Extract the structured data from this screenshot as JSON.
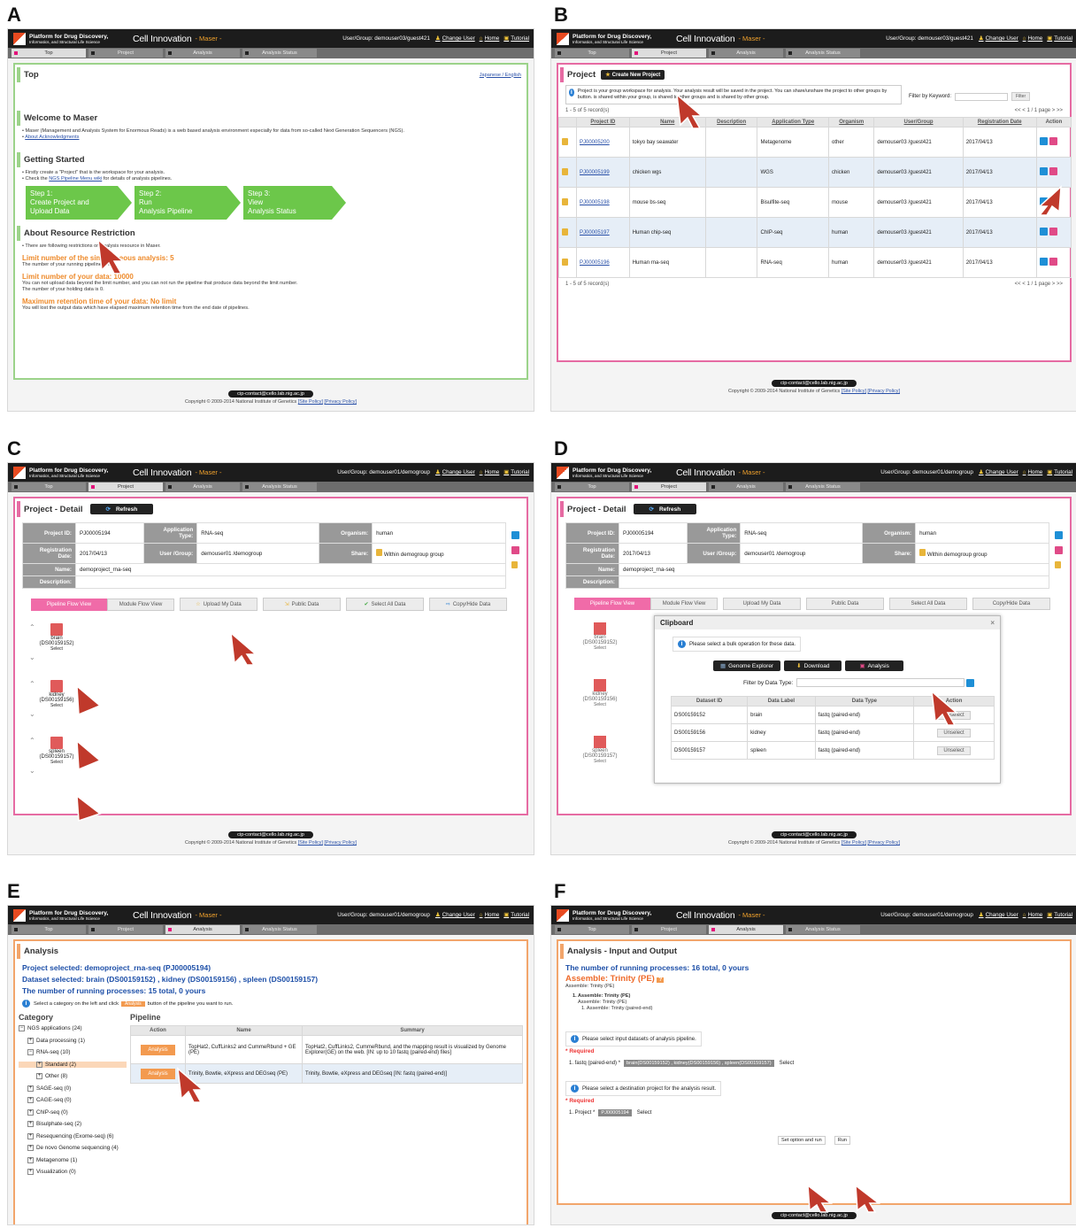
{
  "panel_labels": [
    "A",
    "B",
    "C",
    "D",
    "E",
    "F"
  ],
  "header": {
    "platform": "Platform for Drug Discovery,",
    "platform_sub": "Informatics, and Structural Life Science",
    "nig": "National Institute of Genetics",
    "cellinnovation": "Cell Innovation",
    "maser": "- Maser -",
    "change_user": "Change User",
    "home": "Home",
    "tutorial": "Tutorial",
    "tabs": [
      "Top",
      "Project",
      "Analysis",
      "Analysis Status"
    ]
  },
  "users": {
    "guest": "User/Group: demouser03/guest421",
    "demo": "User/Group: demouser01/demogroup"
  },
  "footer": {
    "contact": "cip-contact@cello.lab.nig.ac.jp",
    "copyright": "Copyright © 2009-2014 National Institute of Genetics",
    "site_policy": "[Site Policy]",
    "privacy_policy": "[Privacy Policy]"
  },
  "panel_a": {
    "title": "Top",
    "lang": "Japanese / English",
    "welcome_title": "Welcome to Maser",
    "welcome_text": "Maser (Management and Analysis System for Enormous Reads) is a web based analysis environment especially for data from so-called Next Generation Sequencers (NGS).",
    "ack_link": "About Acknowledgments",
    "getting_started": "Getting Started",
    "gs_line1": "Firstly create a \"Project\" that is the workspace for your analysis.",
    "gs_line2_pre": "Check the",
    "gs_line2_link": "NGS Pipeline Menu wiki",
    "gs_line2_post": "for details of analysis pipelines.",
    "steps": [
      {
        "l1": "Step 1:",
        "l2": "Create Project and",
        "l3": "Upload Data"
      },
      {
        "l1": "Step 2:",
        "l2": "Run",
        "l3": "Analysis Pipeline"
      },
      {
        "l1": "Step 3:",
        "l2": "View",
        "l3": "Analysis Status"
      }
    ],
    "about_resource": "About Resource Restriction",
    "restriction_intro": "There are following restrictions on analysis resource in Maser.",
    "limit1": "Limit number of the simultaneous analysis: 5",
    "limit1_text": "The number of your running pipeline is 0.",
    "limit2": "Limit number of your data: 10000",
    "limit2_text1": "You can not upload data beyond the limit number, and you can not run the pipeline that produce data beyond the limit number.",
    "limit2_text2": "The number of your holding data is 0.",
    "limit3": "Maximum retention time of your data: No limit",
    "limit3_text": "You will lost the output data which have elapsed maximum retention time from the end date of pipelines."
  },
  "panel_b": {
    "title": "Project",
    "create_btn": "Create New Project",
    "info_text": "Project is your group workspace for analysis. Your analysis result will be saved in the project. You can share/unshare the project to other groups by button. is shared within your group, is shared to other groups and is shared by other group.",
    "filter_label": "Filter by Keyword:",
    "filter_btn": "Filter",
    "records": "1 - 5 of 5 record(s)",
    "pager": "<< < 1 / 1 page > >>",
    "columns": [
      "Project ID",
      "Name",
      "Description",
      "Application Type",
      "Organism",
      "User/Group",
      "Registration Date",
      "Action"
    ],
    "rows": [
      [
        "PJ00005200",
        "tokyo bay seawater",
        "",
        "Metagenome",
        "other",
        "demouser03 /guest421",
        "2017/04/13"
      ],
      [
        "PJ00005199",
        "chicken wgs",
        "",
        "WGS",
        "chicken",
        "demouser03 /guest421",
        "2017/04/13"
      ],
      [
        "PJ00005198",
        "mouse bs-seq",
        "",
        "Bisulfite-seq",
        "mouse",
        "demouser03 /guest421",
        "2017/04/13"
      ],
      [
        "PJ00005197",
        "Human chip-seq",
        "",
        "ChIP-seq",
        "human",
        "demouser03 /guest421",
        "2017/04/13"
      ],
      [
        "PJ00005196",
        "Human rna-seq",
        "",
        "RNA-seq",
        "human",
        "demouser03 /guest421",
        "2017/04/13"
      ]
    ]
  },
  "panel_c": {
    "title": "Project - Detail",
    "refresh": "Refresh",
    "fields": {
      "project_id_k": "Project ID:",
      "project_id": "PJ00005194",
      "app_type_k": "Application Type:",
      "app_type": "RNA-seq",
      "organism_k": "Organism:",
      "organism": "human",
      "reg_k": "Registration Date:",
      "reg": "2017/04/13",
      "user_k": "User /Group:",
      "user": "demouser01 /demogroup",
      "share_k": "Share:",
      "share": "Within demogroup group",
      "name_k": "Name:",
      "name": "demoproject_rna-seq",
      "desc_k": "Description:",
      "desc": ""
    },
    "buttons": [
      "Pipeline Flow View",
      "Module Flow View",
      "Upload My Data",
      "Public Data",
      "Select All Data",
      "Copy/Hide Data"
    ],
    "datasets": [
      {
        "name": "brain",
        "id": "(DS00159152)"
      },
      {
        "name": "kidney",
        "id": "(DS00159156)"
      },
      {
        "name": "spleen",
        "id": "(DS00159157)"
      }
    ],
    "select": "Select"
  },
  "panel_d": {
    "clipboard": "Clipboard",
    "bulk_info": "Please select a bulk operation for these data.",
    "ops": [
      "Genome Explorer",
      "Download",
      "Analysis"
    ],
    "filter_type": "Filter by Data Type:",
    "columns": [
      "Dataset ID",
      "Data Label",
      "Data Type",
      "Action"
    ],
    "rows": [
      [
        "DS00159152",
        "brain",
        "fastq (paired-end)",
        "Unselect"
      ],
      [
        "DS00159156",
        "kidney",
        "fastq (paired-end)",
        "Unselect"
      ],
      [
        "DS00159157",
        "spleen",
        "fastq (paired-end)",
        "Unselect"
      ]
    ]
  },
  "panel_e": {
    "title": "Analysis",
    "project_selected": "Project selected: demoproject_rna-seq (PJ00005194)",
    "dataset_selected": "Dataset selected: brain (DS00159152) , kidney (DS00159156) , spleen (DS00159157)",
    "running": "The number of running processes: 15 total, 0 yours",
    "hint_pre": "Select a category on the left and click",
    "hint_post": "button of the pipeline you want to run.",
    "category_title": "Category",
    "pipeline_title": "Pipeline",
    "categories": [
      {
        "label": "NGS applications (24)",
        "lvl": 0,
        "sign": "−"
      },
      {
        "label": "Data processing (1)",
        "lvl": 1,
        "sign": "+"
      },
      {
        "label": "RNA-seq (10)",
        "lvl": 1,
        "sign": "−"
      },
      {
        "label": "Standard (2)",
        "lvl": 2,
        "sign": "+"
      },
      {
        "label": "Other (8)",
        "lvl": 2,
        "sign": "+"
      },
      {
        "label": "SAGE-seq (0)",
        "lvl": 1,
        "sign": "+"
      },
      {
        "label": "CAGE-seq (0)",
        "lvl": 1,
        "sign": "+"
      },
      {
        "label": "ChIP-seq (0)",
        "lvl": 1,
        "sign": "+"
      },
      {
        "label": "Bisulphate-seq (2)",
        "lvl": 1,
        "sign": "+"
      },
      {
        "label": "Resequencing (Exome-seq) (6)",
        "lvl": 1,
        "sign": "+"
      },
      {
        "label": "De novo Genome sequencing (4)",
        "lvl": 1,
        "sign": "+"
      },
      {
        "label": "Metagenome (1)",
        "lvl": 1,
        "sign": "+"
      },
      {
        "label": "Visualization (0)",
        "lvl": 1,
        "sign": "+"
      }
    ],
    "pipe_cols": [
      "Action",
      "Name",
      "Summary"
    ],
    "pipes": [
      {
        "btn": "Analysis",
        "name": "TopHat2, CuffLinks2 and CummeRbund + GE (PE)",
        "summary": "TopHat2, CuffLinks2, CummeRbund, and the mapping result is visualized by Genome Explorer(GE) on the web. [IN: up to 10 fastq (paired-end) files]"
      },
      {
        "btn": "Analysis",
        "name": "Trinity, Bowtie, eXpress and DEGseq (PE)",
        "summary": "Trinity, Bowtie, eXpress and DEGseq [IN: fastq (paired-end)]"
      }
    ]
  },
  "panel_f": {
    "title": "Analysis - Input and Output",
    "running": "The number of running processes: 16 total, 0 yours",
    "assemble": "Assemble: Trinity (PE)",
    "assemble_sub": "Assemble: Trinity (PE)",
    "tree1": "1. Assemble: Trinity (PE)",
    "tree2": "Assemble: Trinity (PE)",
    "tree3": "1. Assemble: Trinity (paired-end)",
    "input_info": "Please select input datasets of analysis pipeline.",
    "required": "* Required",
    "fastq_label": "1. fastq (paired-end) *",
    "fastq_value": "brain(DS00159152) , kidney(DS00159156) , spleen(DS00159157)",
    "select": "Select",
    "dest_info": "Please select a destination project for the analysis result.",
    "project_label": "1. Project *",
    "project_value": "PJ00005194",
    "set_option": "Set option and run",
    "run": "Run"
  }
}
